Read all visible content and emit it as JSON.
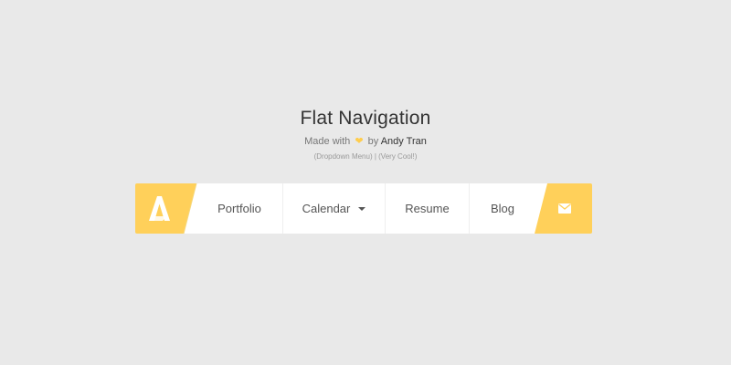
{
  "header": {
    "title": "Flat Navigation",
    "made_with": "Made with",
    "by": "by",
    "author": "Andy Tran",
    "subtitle_small": "(Dropdown Menu) | (Very Cool!)"
  },
  "nav": {
    "logo_letter": "A",
    "items": [
      {
        "label": "Portfolio"
      },
      {
        "label": "Calendar"
      },
      {
        "label": "Resume"
      },
      {
        "label": "Blog"
      }
    ],
    "mail_icon": "envelope-icon"
  },
  "colors": {
    "background": "#e9e9e9",
    "accent": "#ffd05a",
    "nav_white": "#ffffff",
    "text": "#555555"
  }
}
